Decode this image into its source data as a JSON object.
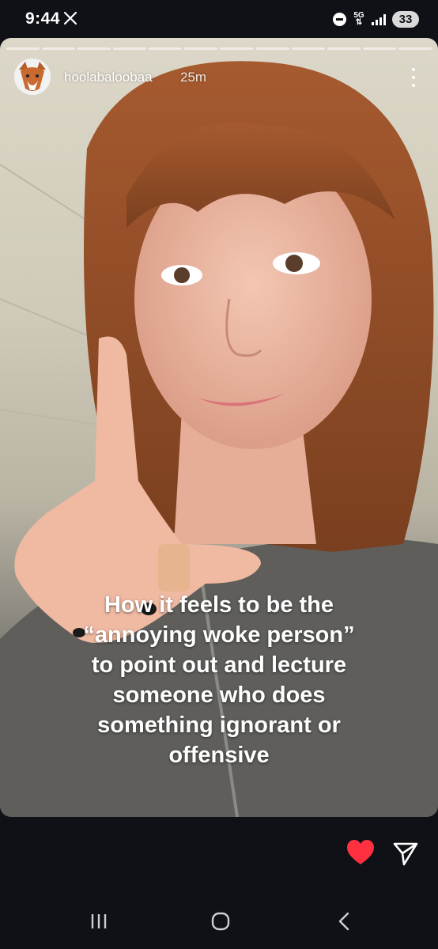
{
  "status_bar": {
    "time": "9:44",
    "network": "5G",
    "battery": "33",
    "icons": [
      "x-logo-icon",
      "do-not-disturb-icon",
      "5g-icon",
      "signal-icon",
      "battery-icon"
    ]
  },
  "story": {
    "segment_count": 12,
    "username": "hoolabaloobaa",
    "timestamp": "25m",
    "caption": "How it feels to be the\n“annoying woke person”\nto point out and lecture\nsomeone who does\nsomething ignorant or\noffensive"
  },
  "actions": {
    "icons": [
      "heart-icon",
      "send-icon"
    ],
    "heart_color": "#ff3040"
  },
  "nav": {
    "icons": [
      "recent-apps-icon",
      "home-icon",
      "back-icon"
    ]
  }
}
